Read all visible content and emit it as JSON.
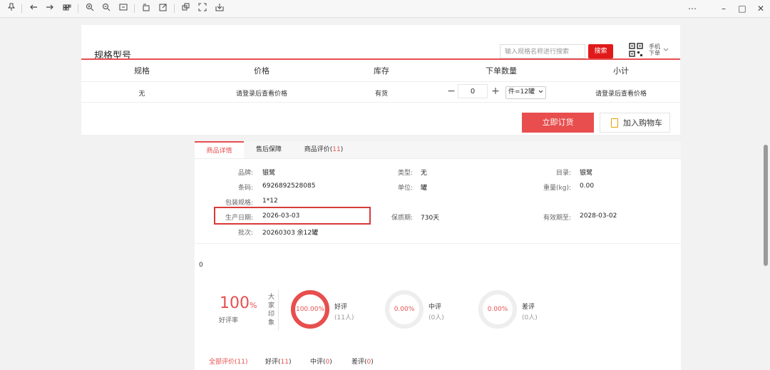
{
  "toolbar": {
    "icons": [
      "pin-icon",
      "back-icon",
      "forward-icon",
      "thumbnails-icon",
      "zoom-in-icon",
      "zoom-out-icon",
      "fit-page-icon",
      "rotate-icon",
      "edit-icon",
      "copy-icon",
      "screenshot-icon",
      "export-icon"
    ],
    "window": {
      "more": "⋯",
      "minimize": "–",
      "maximize": "□",
      "close": "✕"
    }
  },
  "spec": {
    "title": "规格型号",
    "search_placeholder": "输入规格名称进行搜索",
    "search_button": "搜索",
    "mobile_order": [
      "手机",
      "下单"
    ],
    "headers": [
      "规格",
      "价格",
      "库存",
      "下单数量",
      "小计"
    ],
    "row": {
      "spec": "无",
      "price": "请登录后查看价格",
      "stock": "有货",
      "quantity": "0",
      "unit": "件=12罐",
      "subtotal": "请登录后查看价格"
    },
    "buy_now": "立即订货",
    "add_to_cart": "加入购物车"
  },
  "tabs": {
    "detail": "商品详情",
    "after_sale": "售后保障",
    "reviews_label": "商品评价(",
    "reviews_count": "11",
    "reviews_close": ")"
  },
  "details": {
    "brand_label": "品牌:",
    "brand": "银鹭",
    "type_label": "类型:",
    "type": "无",
    "catalog_label": "目录:",
    "catalog": "银鹭",
    "barcode_label": "条码:",
    "barcode": "6926892528085",
    "unit_label": "单位:",
    "unit": "罐",
    "weight_label": "重量(kg):",
    "weight": "0.00",
    "pack_label": "包装规格:",
    "pack": "1*12",
    "prod_date_label": "生产日期:",
    "prod_date": "2026-03-03",
    "shelf_label": "保质期:",
    "shelf": "730天",
    "expiry_label": "有效期至:",
    "expiry": "2028-03-02",
    "batch_label": "批次:",
    "batch": "20260303 余12罐"
  },
  "ratings": {
    "zero": "0",
    "good_rate_value": "100",
    "good_rate_unit": "%",
    "good_rate_label": "好评率",
    "impression": "大家印象",
    "rings": [
      {
        "pct": "100.00%",
        "name": "好评",
        "count": "(11人)",
        "fraction": 1.0
      },
      {
        "pct": "0.00%",
        "name": "中评",
        "count": "(0人)",
        "fraction": 0.0
      },
      {
        "pct": "0.00%",
        "name": "差评",
        "count": "(0人)",
        "fraction": 0.0
      }
    ],
    "filter_tabs": [
      {
        "label": "全部评价(",
        "count": "11"
      },
      {
        "label": "好评(",
        "count": "11"
      },
      {
        "label": "中评(",
        "count": "0"
      },
      {
        "label": "差评(",
        "count": "0"
      }
    ],
    "close_paren": ")"
  },
  "colors": {
    "accent": "#e84e4e",
    "search_red": "#e01a1a",
    "ring_empty": "#eeeeee"
  }
}
